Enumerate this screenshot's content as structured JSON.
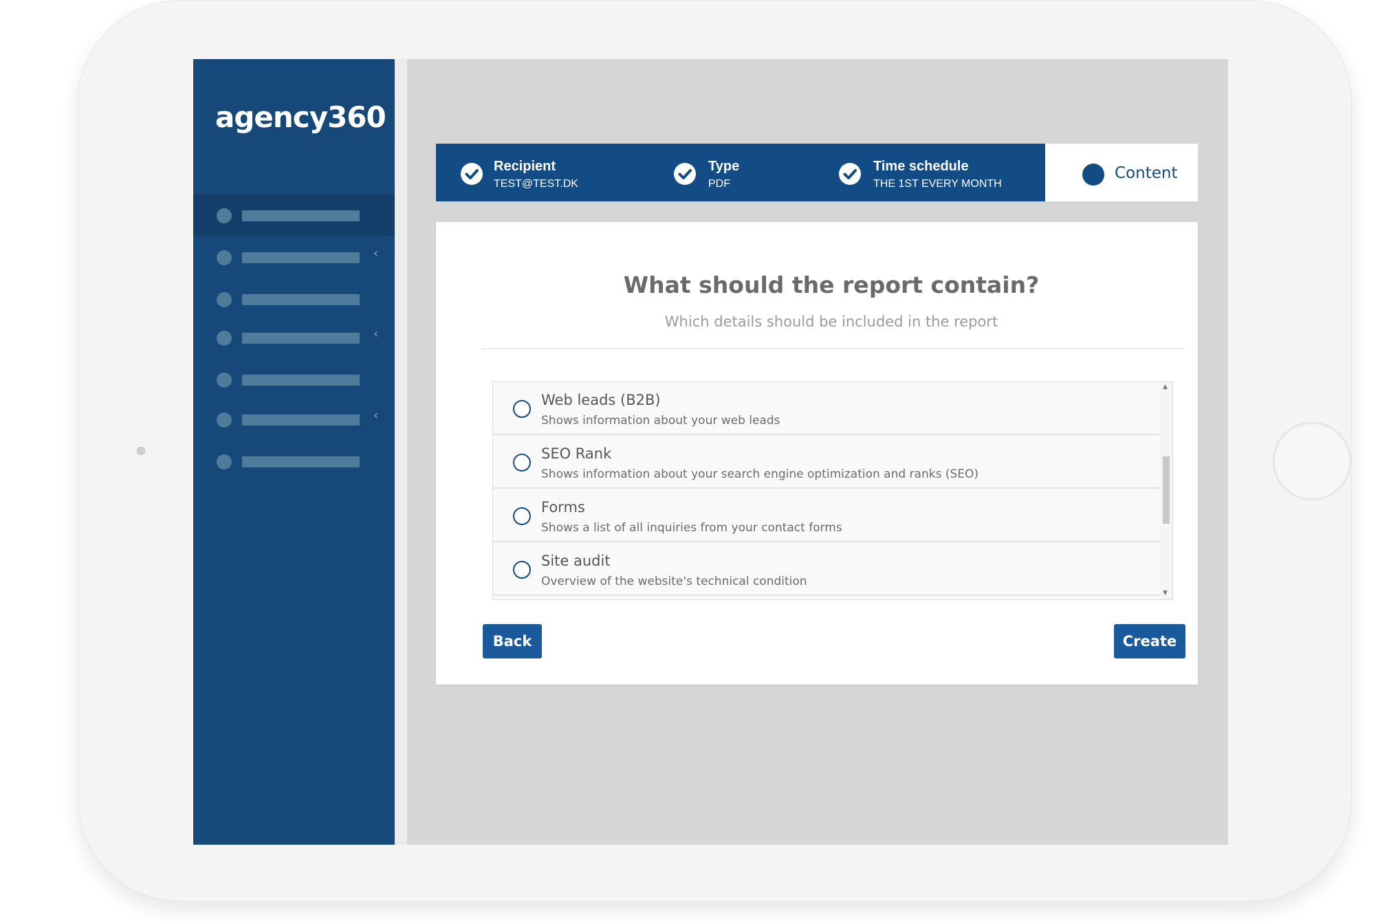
{
  "sidebar": {
    "logo": "agency360",
    "items": [
      {
        "active": true,
        "has_submenu": false
      },
      {
        "active": false,
        "has_submenu": true
      },
      {
        "active": false,
        "has_submenu": false
      },
      {
        "active": false,
        "has_submenu": true
      },
      {
        "active": false,
        "has_submenu": false
      },
      {
        "active": false,
        "has_submenu": true
      },
      {
        "active": false,
        "has_submenu": false
      }
    ],
    "chevron": "‹"
  },
  "stepper": {
    "steps": [
      {
        "title": "Recipient",
        "subtitle": "TEST@TEST.DK",
        "icon": "check-circle-icon",
        "state": "done"
      },
      {
        "title": "Type",
        "subtitle": "PDF",
        "icon": "check-circle-icon",
        "state": "done"
      },
      {
        "title": "Time schedule",
        "subtitle": "THE 1ST EVERY MONTH",
        "icon": "check-circle-icon",
        "state": "done"
      }
    ],
    "active": {
      "title": "Content",
      "icon": "filled-circle-icon",
      "state": "current"
    }
  },
  "content": {
    "title": "What should the report contain?",
    "subtitle": "Which details should be included in the report",
    "options": [
      {
        "title": "Web leads (B2B)",
        "description": "Shows information about your web leads",
        "selected": false
      },
      {
        "title": "SEO Rank",
        "description": "Shows information about your search engine optimization and ranks (SEO)",
        "selected": false
      },
      {
        "title": "Forms",
        "description": "Shows a list of all inquiries from your contact forms",
        "selected": false
      },
      {
        "title": "Site audit",
        "description": "Overview of the website's technical condition",
        "selected": false
      }
    ],
    "scroll_up": "▲",
    "scroll_down": "▼"
  },
  "buttons": {
    "back": "Back",
    "create": "Create"
  },
  "colors": {
    "brand": "#134b84",
    "sidebar": "#16497a",
    "button": "#1a5a9c"
  }
}
